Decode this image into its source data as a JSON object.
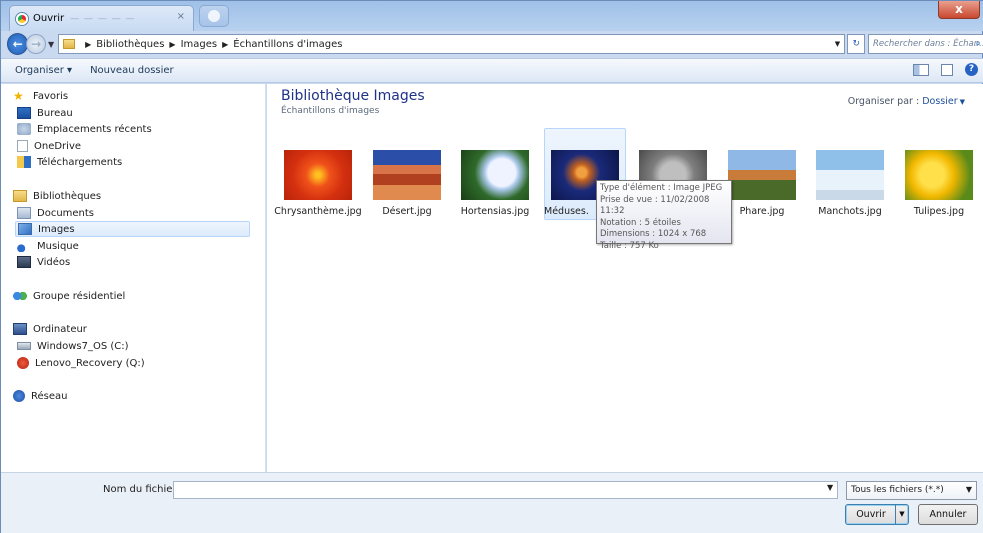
{
  "window": {
    "title": "Ouvrir",
    "tab_ghost_text": "— — — — —",
    "close_glyph": "x"
  },
  "address_bar": {
    "breadcrumb": [
      "Bibliothèques",
      "Images",
      "Échantillons d'images"
    ],
    "search_placeholder": "Rechercher dans : Échan...",
    "back_glyph": "←",
    "forward_glyph": "→",
    "refresh_glyph": "↻",
    "search_glyph": "⌕"
  },
  "toolbar": {
    "organize": "Organiser ▾",
    "new_folder": "Nouveau dossier",
    "help_glyph": "?"
  },
  "nav": {
    "favorites": "Favoris",
    "desktop": "Bureau",
    "recent": "Emplacements récents",
    "onedrive": "OneDrive",
    "downloads": "Téléchargements",
    "libraries": "Bibliothèques",
    "documents": "Documents",
    "images": "Images",
    "music": "Musique",
    "videos": "Vidéos",
    "homegroup": "Groupe résidentiel",
    "computer": "Ordinateur",
    "drive_c": "Windows7_OS (C:)",
    "drive_q": "Lenovo_Recovery (Q:)",
    "network": "Réseau",
    "selected": "Images"
  },
  "content": {
    "library_title": "Bibliothèque Images",
    "library_subtitle": "Échantillons d'images",
    "arrange_label": "Organiser par :",
    "arrange_value": "Dossier",
    "files": [
      {
        "name": "Chrysanthème.jpg",
        "thumb": "chrysanthemum"
      },
      {
        "name": "Désert.jpg",
        "thumb": "desert"
      },
      {
        "name": "Hortensias.jpg",
        "thumb": "hydrangea"
      },
      {
        "name": "Méduses.",
        "thumb": "jellyfish"
      },
      {
        "name": "",
        "thumb": "koala"
      },
      {
        "name": "Phare.jpg",
        "thumb": "lighthouse"
      },
      {
        "name": "Manchots.jpg",
        "thumb": "penguins"
      },
      {
        "name": "Tulipes.jpg",
        "thumb": "tulips"
      }
    ],
    "hovered_file": "Méduses"
  },
  "tooltip": {
    "type": "Type d'élément : Image JPEG",
    "taken": "Prise de vue : 11/02/2008 11:32",
    "rating": "Notation : 5 étoiles",
    "dimensions": "Dimensions : 1024 x 768",
    "size": "Taille : 757 Ko"
  },
  "bottom": {
    "filename_label": "Nom du fichier :",
    "filename_value": "",
    "filter_value": "Tous les fichiers (*.*)",
    "open_button": "Ouvrir",
    "cancel_button": "Annuler"
  },
  "colors": {
    "accent_title": "#1e3287",
    "selection_bg": "#dcebfc",
    "link": "#1e4f9a"
  }
}
